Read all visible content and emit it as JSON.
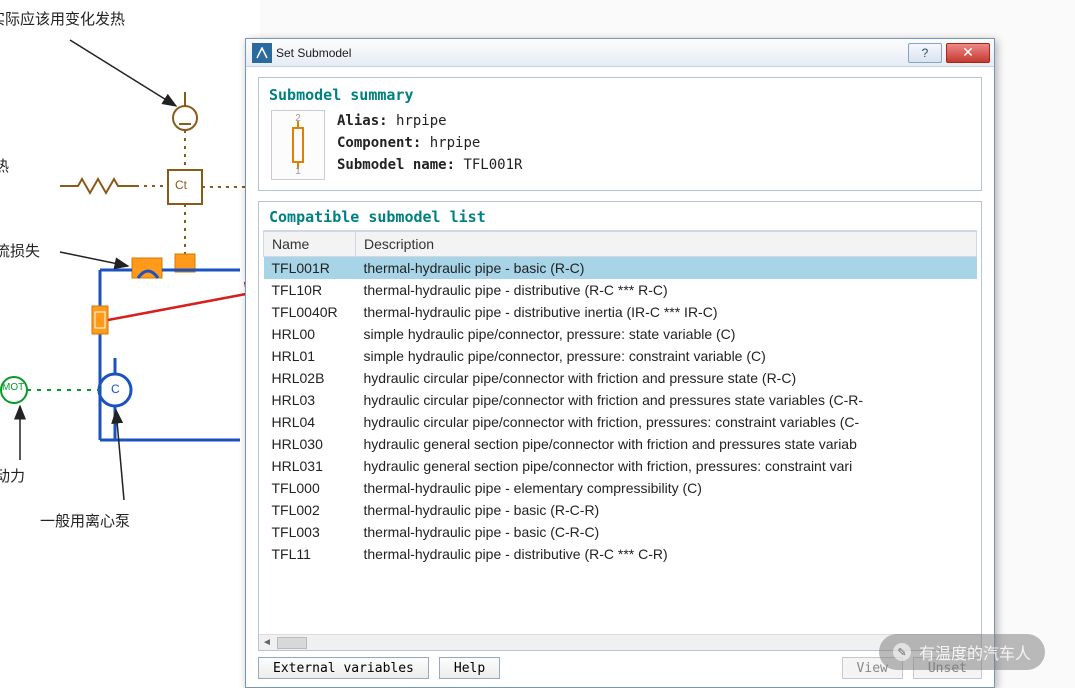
{
  "canvas": {
    "labels": {
      "top": "热，实际应该用变化发热",
      "left_heat": "热",
      "throttle": "节流损失",
      "drive": "驱动力",
      "pump": "一般用离心泵",
      "ct": "Ct",
      "mot": "MOT",
      "cap": "C"
    }
  },
  "dialog": {
    "title": "Set Submodel",
    "summary": {
      "heading": "Submodel summary",
      "alias_k": "Alias:",
      "alias_v": "hrpipe",
      "comp_k": "Component:",
      "comp_v": "hrpipe",
      "name_k": "Submodel name:",
      "name_v": "TFL001R",
      "port1": "1",
      "port2": "2"
    },
    "list": {
      "heading": "Compatible submodel list",
      "col_name": "Name",
      "col_desc": "Description",
      "rows": [
        {
          "name": "TFL001R",
          "desc": "thermal-hydraulic pipe - basic (R-C)",
          "sel": true
        },
        {
          "name": "TFL10R",
          "desc": "thermal-hydraulic pipe - distributive (R-C *** R-C)"
        },
        {
          "name": "TFL0040R",
          "desc": "thermal-hydraulic pipe - distributive inertia (IR-C *** IR-C)"
        },
        {
          "name": "HRL00",
          "desc": "simple hydraulic pipe/connector, pressure: state variable (C)"
        },
        {
          "name": "HRL01",
          "desc": "simple hydraulic pipe/connector, pressure: constraint variable (C)"
        },
        {
          "name": "HRL02B",
          "desc": "hydraulic circular pipe/connector with friction and pressure state (R-C)"
        },
        {
          "name": "HRL03",
          "desc": "hydraulic circular pipe/connector with friction and pressures state variables (C-R-"
        },
        {
          "name": "HRL04",
          "desc": "hydraulic circular pipe/connector with friction, pressures: constraint variables (C-"
        },
        {
          "name": "HRL030",
          "desc": "hydraulic general section pipe/connector with friction and pressures state variab"
        },
        {
          "name": "HRL031",
          "desc": "hydraulic general section pipe/connector with friction, pressures: constraint vari"
        },
        {
          "name": "TFL000",
          "desc": "thermal-hydraulic pipe - elementary compressibility (C)"
        },
        {
          "name": "TFL002",
          "desc": "thermal-hydraulic pipe - basic (R-C-R)"
        },
        {
          "name": "TFL003",
          "desc": "thermal-hydraulic pipe - basic (C-R-C)"
        },
        {
          "name": "TFL11",
          "desc": "thermal-hydraulic pipe - distributive (R-C *** C-R)"
        }
      ]
    },
    "buttons": {
      "ext_vars": "External variables",
      "help": "Help",
      "view": "View",
      "unset": "Unset"
    }
  },
  "watermark": "有温度的汽车人"
}
